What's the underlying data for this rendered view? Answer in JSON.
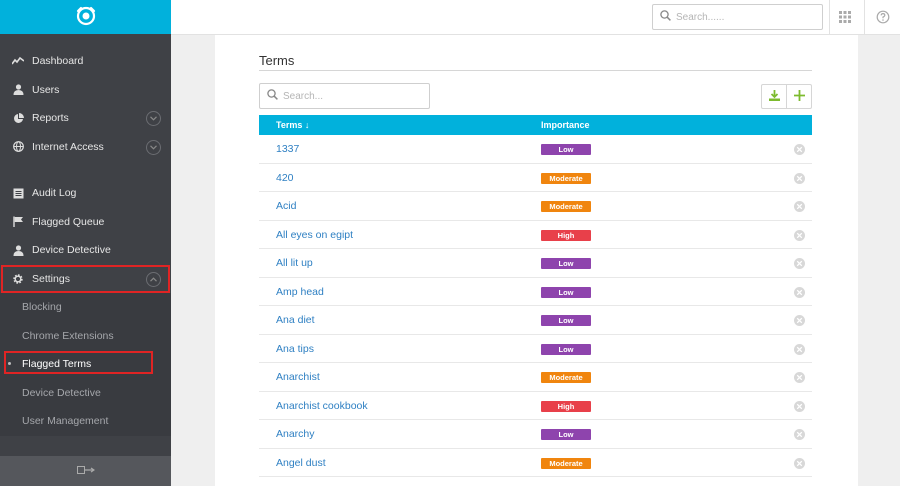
{
  "topbar": {
    "search_placeholder": "Search......"
  },
  "sidebar": {
    "nav": [
      {
        "label": "Dashboard",
        "icon": "activity-icon"
      },
      {
        "label": "Users",
        "icon": "user-icon"
      },
      {
        "label": "Reports",
        "icon": "pie-chart-icon",
        "expandable": true
      },
      {
        "label": "Internet Access",
        "icon": "globe-icon",
        "expandable": true
      }
    ],
    "nav2": [
      {
        "label": "Audit Log",
        "icon": "log-icon"
      },
      {
        "label": "Flagged Queue",
        "icon": "flag-icon"
      },
      {
        "label": "Device Detective",
        "icon": "user-icon"
      }
    ],
    "settings": {
      "label": "Settings",
      "icon": "gear-icon",
      "expanded": true
    },
    "sub_items": [
      {
        "label": "Blocking"
      },
      {
        "label": "Chrome Extensions"
      },
      {
        "label": "Flagged Terms",
        "active": true
      },
      {
        "label": "Device Detective"
      },
      {
        "label": "User Management"
      }
    ]
  },
  "page": {
    "title": "Terms",
    "search_placeholder": "Search..."
  },
  "table": {
    "columns": {
      "terms": "Terms ↓",
      "importance": "Importance"
    },
    "rows": [
      {
        "term": "1337",
        "importance": "Low"
      },
      {
        "term": "420",
        "importance": "Moderate"
      },
      {
        "term": "Acid",
        "importance": "Moderate"
      },
      {
        "term": "All eyes on egipt",
        "importance": "High"
      },
      {
        "term": "All lit up",
        "importance": "Low"
      },
      {
        "term": "Amp head",
        "importance": "Low"
      },
      {
        "term": "Ana diet",
        "importance": "Low"
      },
      {
        "term": "Ana tips",
        "importance": "Low"
      },
      {
        "term": "Anarchist",
        "importance": "Moderate"
      },
      {
        "term": "Anarchist cookbook",
        "importance": "High"
      },
      {
        "term": "Anarchy",
        "importance": "Low"
      },
      {
        "term": "Angel dust",
        "importance": "Moderate"
      }
    ]
  },
  "colors": {
    "accent": "#01b1dc",
    "sidebar": "#3f4146",
    "link": "#2f80c3",
    "low": "#8e44ad",
    "moderate": "#f0850e",
    "high": "#e8404a",
    "action_green": "#7dbb2e",
    "highlight_red": "#e02424"
  }
}
